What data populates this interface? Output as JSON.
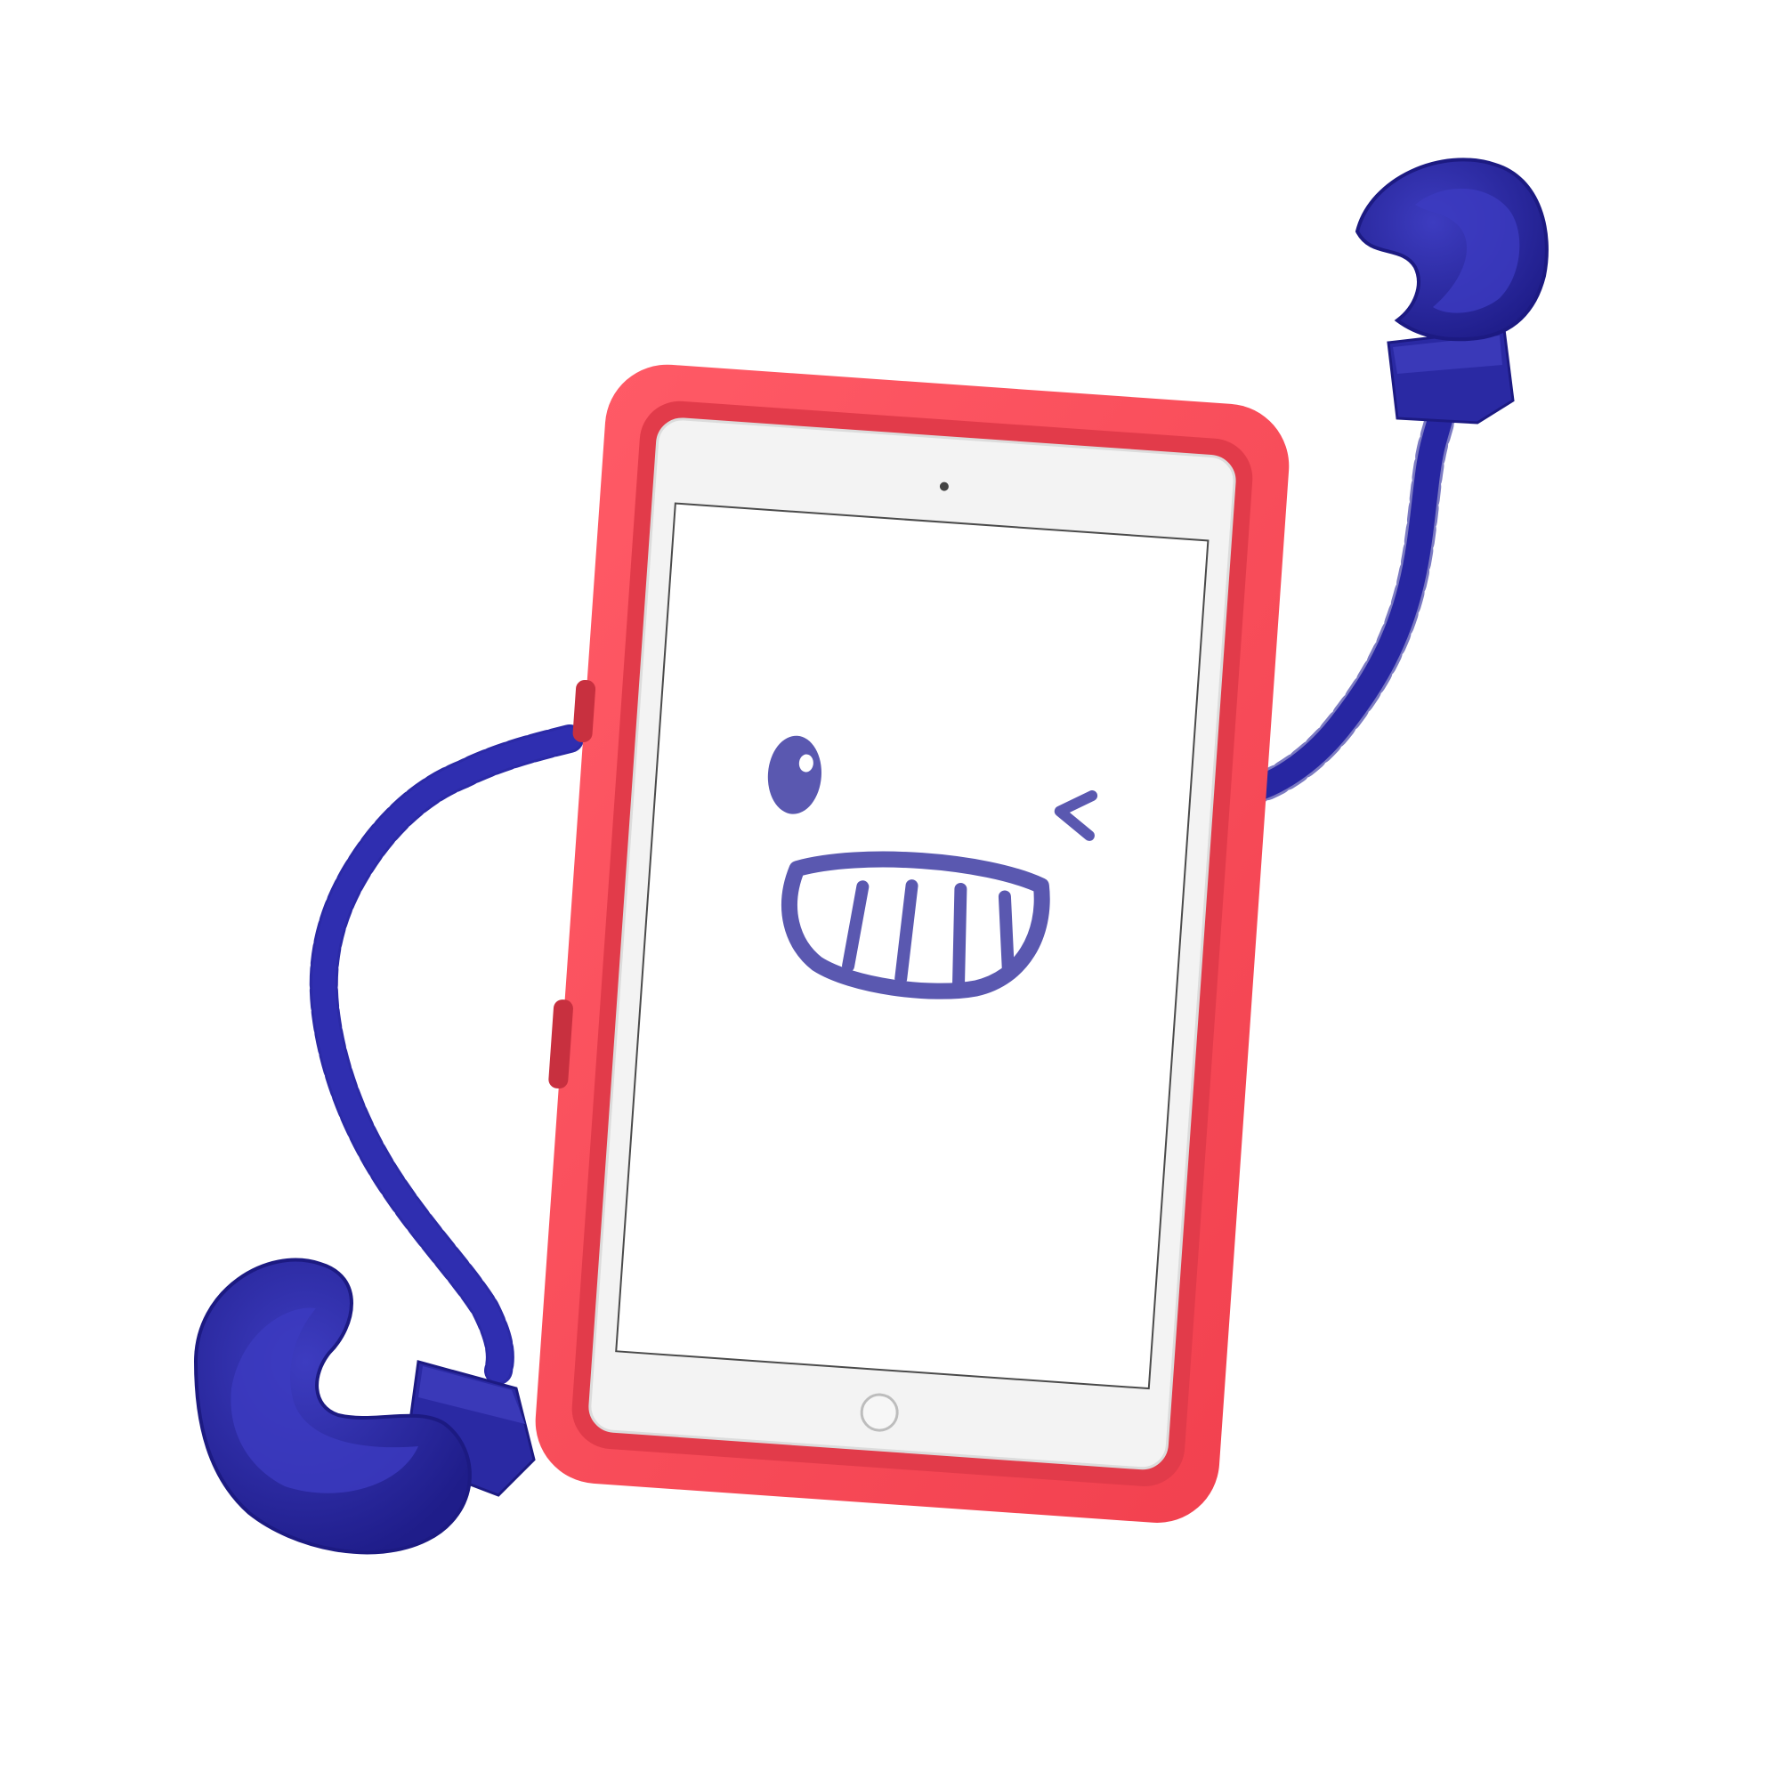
{
  "scene": {
    "subject": "tablet-case-character",
    "background": "#ffffff",
    "colors": {
      "case_red": "#ff4e5c",
      "case_red_shadow": "#d93a49",
      "case_red_inner": "#e8404f",
      "arm_blue": "#2b2aa6",
      "arm_blue_dark": "#1c1a82",
      "arm_blue_light": "#4a4ac4",
      "bezel": "#f3f3f3",
      "screen": "#ffffff",
      "face": "#5a58b0"
    },
    "icons": {
      "camera": "camera-dot-icon",
      "home_button": "home-button-icon",
      "left_glove": "boxing-glove-icon",
      "right_glove": "boxing-glove-icon"
    },
    "face": {
      "open_eye": "round-eye",
      "wink_eye": "wink-caret",
      "mouth": "grin-with-teeth",
      "teeth_count": 4
    }
  }
}
